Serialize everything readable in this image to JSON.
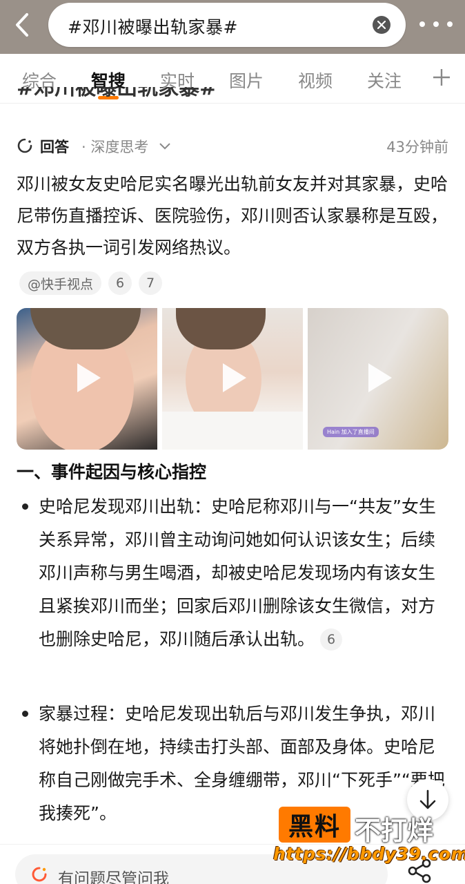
{
  "header": {
    "search_query": "#邓川被曝出轨家暴#",
    "back_icon": "back-arrow-icon",
    "clear_icon": "clear-icon",
    "more_icon": "more-dots-icon"
  },
  "tabs": [
    {
      "label": "综合"
    },
    {
      "label": "智搜"
    },
    {
      "label": "实时"
    },
    {
      "label": "图片"
    },
    {
      "label": "视频"
    },
    {
      "label": "关注"
    }
  ],
  "active_tab": "智搜",
  "scrolled_title": "#邓川被曝出轨家暴#",
  "answer": {
    "label": "回答",
    "mode": "· 深度思考",
    "time": "43分钟前",
    "summary": "邓川被女友史哈尼实名曝光出轨前女友并对其家暴，史哈尼带伤直播控诉、医院验伤，邓川则否认家暴称是互殴，双方各执一词引发网络热议。",
    "source": "@快手视点",
    "refs": [
      "6",
      "7"
    ]
  },
  "videos": [
    {
      "name": "video-1"
    },
    {
      "name": "video-2"
    },
    {
      "name": "video-3",
      "overlay": "Hain 加入了直播间"
    }
  ],
  "section": {
    "title": "一、事件起因与核心指控",
    "bullets": [
      {
        "text": "史哈尼发现邓川出轨：史哈尼称邓川与一“共友”女生关系异常，邓川曾主动询问她如何认识该女生；后续邓川声称与男生喝酒，却被史哈尼发现场内有该女生且紧挨邓川而坐；回家后邓川删除该女生微信，对方也删除史哈尼，邓川随后承认出轨。",
        "ref": "6"
      },
      {
        "text": "家暴过程：史哈尼发现出轨后与邓川发生争执，邓川将她扑倒在地，持续击打头部、面部及身体。史哈尼称自己刚做完手术、全身缠绷带，邓川“下死手”“要把我揍死”。",
        "ref": ""
      }
    ]
  },
  "watermark": {
    "left": "黑料",
    "right": "不打烊",
    "url": "https://bbdy39.com"
  },
  "ask_bar": {
    "placeholder": "有问题尽管问我"
  },
  "colors": {
    "accent": "#ff7a00",
    "header_bg": "#9a9189"
  }
}
